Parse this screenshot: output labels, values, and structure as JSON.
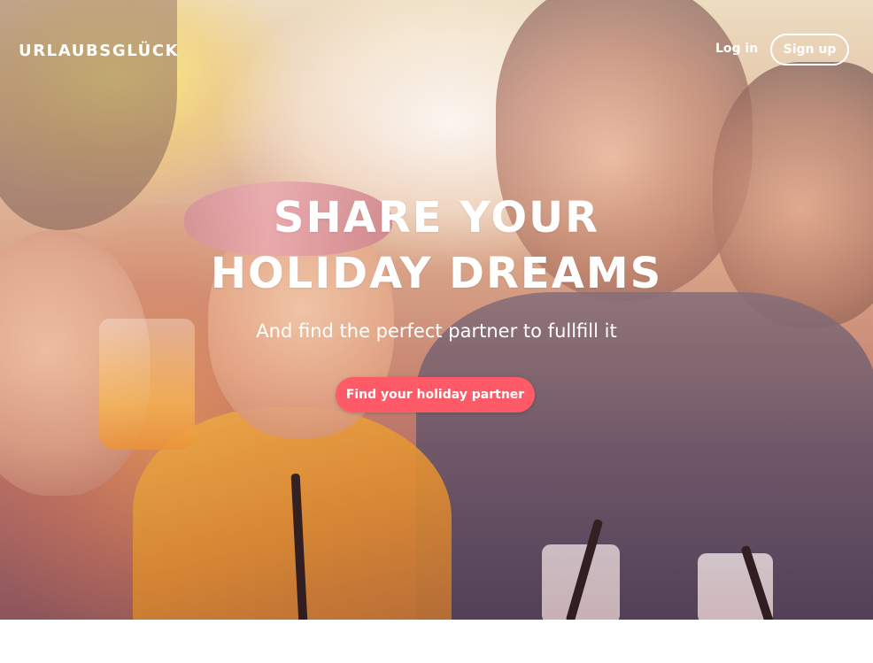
{
  "brand": {
    "name": "URLAUBSGLÜCK"
  },
  "nav": {
    "login_label": "Log in",
    "signup_label": "Sign up"
  },
  "hero": {
    "headline_line1": "SHARE YOUR",
    "headline_line2": "HOLIDAY DREAMS",
    "subheadline": "And find the perfect partner to fullfill it",
    "cta_label": "Find your holiday partner",
    "background": {
      "description_icon": "photo-background"
    }
  },
  "colors": {
    "cta": "#ff5a67",
    "text": "#ffffff",
    "background_bottom": "#ffffff"
  }
}
